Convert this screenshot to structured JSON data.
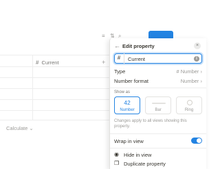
{
  "toolbar": {
    "icons": [
      "filter-icon",
      "sort-icon",
      "search-icon",
      "more-icon"
    ],
    "new_button_color": "#2383e2"
  },
  "table": {
    "column_header": "Current",
    "column_icon": "#",
    "add_column": "+",
    "calculate": "Calculate ⌄"
  },
  "panel": {
    "title": "Edit property",
    "back": "←",
    "close": "×",
    "name_icon": "#",
    "name_value": "Current",
    "type_label": "Type",
    "type_value": "# Number ›",
    "format_label": "Number format",
    "format_value": "Number ›",
    "show_as_label": "Show as",
    "options": [
      {
        "preview": "42",
        "caption": "Number",
        "selected": true
      },
      {
        "preview": "",
        "caption": "Bar",
        "selected": false
      },
      {
        "preview": "",
        "caption": "Ring",
        "selected": false
      }
    ],
    "note": "Changes apply to all views showing this property.",
    "wrap_label": "Wrap in view",
    "wrap_on": true,
    "hide_label": "Hide in view",
    "duplicate_label": "Duplicate property"
  },
  "colors": {
    "accent": "#2383e2",
    "text": "#37352f",
    "muted": "#9b9a97"
  }
}
